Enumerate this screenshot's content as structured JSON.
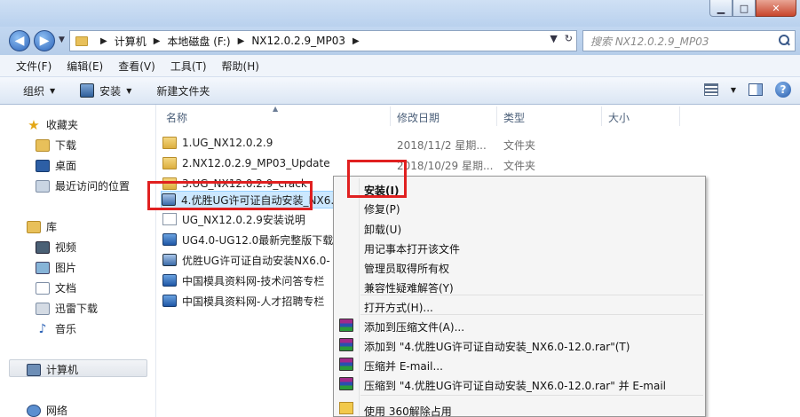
{
  "window": {
    "minimize": "▁",
    "maximize": "□",
    "close": "✕"
  },
  "address": {
    "crumbs": [
      "计算机",
      "本地磁盘 (F:)",
      "NX12.0.2.9_MP03"
    ],
    "search_placeholder": "搜索 NX12.0.2.9_MP03"
  },
  "menubar": [
    "文件(F)",
    "编辑(E)",
    "查看(V)",
    "工具(T)",
    "帮助(H)"
  ],
  "toolbar": {
    "organize": "组织",
    "install": "安装",
    "new_folder": "新建文件夹"
  },
  "nav": {
    "favorites": "收藏夹",
    "downloads": "下载",
    "desktop": "桌面",
    "recent": "最近访问的位置",
    "libraries": "库",
    "videos": "视频",
    "pictures": "图片",
    "documents": "文档",
    "thunder": "迅雷下载",
    "music": "音乐",
    "computer": "计算机",
    "network": "网络"
  },
  "columns": {
    "name": "名称",
    "date": "修改日期",
    "type": "类型",
    "size": "大小"
  },
  "files": [
    {
      "name": "1.UG_NX12.0.2.9",
      "date": "2018/11/2 星期...",
      "type": "文件夹",
      "icon": "folder-icon"
    },
    {
      "name": "2.NX12.0.2.9_MP03_Update",
      "date": "2018/10/29 星期...",
      "type": "文件夹",
      "icon": "folder-icon"
    },
    {
      "name": "3.UG_NX12.0.2.9_crack",
      "date": "",
      "type": "",
      "icon": "folder-icon"
    },
    {
      "name": "4.优胜UG许可证自动安装_NX6.",
      "date": "",
      "type": "",
      "icon": "installer-icon"
    },
    {
      "name": "UG_NX12.0.2.9安装说明",
      "date": "",
      "type": "",
      "icon": "text-file-icon"
    },
    {
      "name": "UG4.0-UG12.0最新完整版下载",
      "date": "",
      "type": "",
      "icon": "shortcut-icon"
    },
    {
      "name": "优胜UG许可证自动安装NX6.0-",
      "date": "",
      "type": "",
      "icon": "installer-icon"
    },
    {
      "name": "中国模具资料网-技术问答专栏",
      "date": "",
      "type": "",
      "icon": "shortcut-icon"
    },
    {
      "name": "中国模具资料网-人才招聘专栏",
      "date": "",
      "type": "",
      "icon": "shortcut-icon"
    }
  ],
  "context_menu": {
    "install": "安装(I)",
    "repair": "修复(P)",
    "uninstall": "卸载(U)",
    "open_notepad": "用记事本打开该文件",
    "take_ownership": "管理员取得所有权",
    "compat": "兼容性疑难解答(Y)",
    "open_with": "打开方式(H)...",
    "add_archive": "添加到压缩文件(A)...",
    "add_to_rar": "添加到 \"4.优胜UG许可证自动安装_NX6.0-12.0.rar\"(T)",
    "compress_email": "压缩并 E-mail...",
    "compress_rar_email": "压缩到 \"4.优胜UG许可证自动安装_NX6.0-12.0.rar\" 并 E-mail",
    "unlock_360": "使用 360解除占用"
  }
}
